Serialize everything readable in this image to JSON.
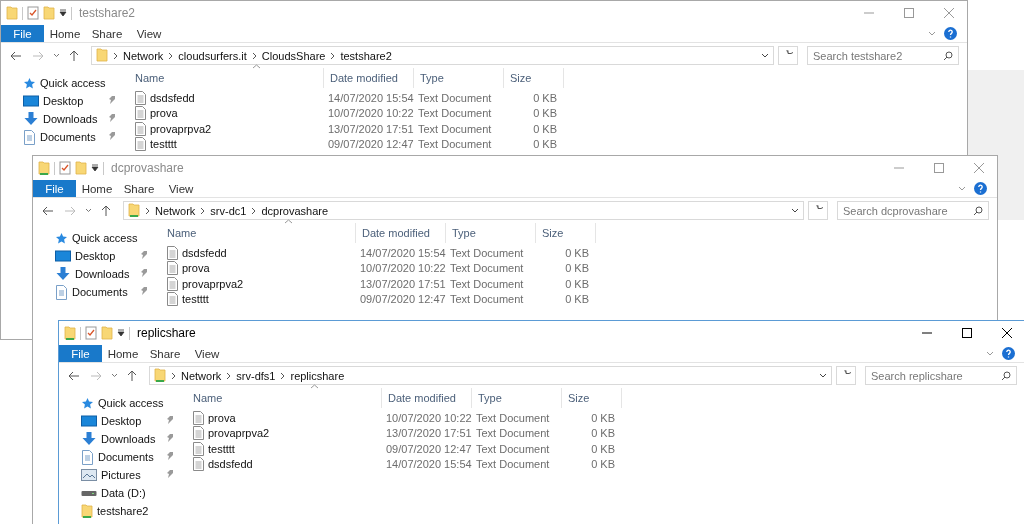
{
  "windows": [
    {
      "title": "testshare2",
      "active": false,
      "ribbon_tabs": [
        {
          "label": "File",
          "kind": "file"
        },
        {
          "label": "Home",
          "kind": "tab"
        },
        {
          "label": "Share",
          "kind": "tab"
        },
        {
          "label": "View",
          "kind": "tab"
        }
      ],
      "path": [
        "Network",
        "cloudsurfers.it",
        "CloudsShare",
        "testshare2"
      ],
      "search": {
        "placeholder": "Search testshare2"
      },
      "sidebar": [
        {
          "label": "Quick access",
          "pinned": false
        },
        {
          "label": "Desktop",
          "pinned": true
        },
        {
          "label": "Downloads",
          "pinned": true
        },
        {
          "label": "Documents",
          "pinned": true
        }
      ],
      "columns": [
        "Name",
        "Date modified",
        "Type",
        "Size"
      ],
      "files": [
        {
          "name": "dsdsfedd",
          "date": "14/07/2020 15:54",
          "type": "Text Document",
          "size": "0 KB"
        },
        {
          "name": "prova",
          "date": "10/07/2020 10:22",
          "type": "Text Document",
          "size": "0 KB"
        },
        {
          "name": "provaprpva2",
          "date": "13/07/2020 17:51",
          "type": "Text Document",
          "size": "0 KB"
        },
        {
          "name": "testttt",
          "date": "09/07/2020 12:47",
          "type": "Text Document",
          "size": "0 KB"
        }
      ]
    },
    {
      "title": "dcprovashare",
      "active": false,
      "ribbon_tabs": [
        {
          "label": "File",
          "kind": "file"
        },
        {
          "label": "Home",
          "kind": "tab"
        },
        {
          "label": "Share",
          "kind": "tab"
        },
        {
          "label": "View",
          "kind": "tab"
        }
      ],
      "path": [
        "Network",
        "srv-dc1",
        "dcprovashare"
      ],
      "search": {
        "placeholder": "Search dcprovashare"
      },
      "sidebar": [
        {
          "label": "Quick access",
          "pinned": false
        },
        {
          "label": "Desktop",
          "pinned": true
        },
        {
          "label": "Downloads",
          "pinned": true
        },
        {
          "label": "Documents",
          "pinned": true
        }
      ],
      "columns": [
        "Name",
        "Date modified",
        "Type",
        "Size"
      ],
      "files": [
        {
          "name": "dsdsfedd",
          "date": "14/07/2020 15:54",
          "type": "Text Document",
          "size": "0 KB"
        },
        {
          "name": "prova",
          "date": "10/07/2020 10:22",
          "type": "Text Document",
          "size": "0 KB"
        },
        {
          "name": "provaprpva2",
          "date": "13/07/2020 17:51",
          "type": "Text Document",
          "size": "0 KB"
        },
        {
          "name": "testttt",
          "date": "09/07/2020 12:47",
          "type": "Text Document",
          "size": "0 KB"
        }
      ]
    },
    {
      "title": "replicshare",
      "active": true,
      "ribbon_tabs": [
        {
          "label": "File",
          "kind": "file"
        },
        {
          "label": "Home",
          "kind": "tab"
        },
        {
          "label": "Share",
          "kind": "tab"
        },
        {
          "label": "View",
          "kind": "tab"
        }
      ],
      "path": [
        "Network",
        "srv-dfs1",
        "replicshare"
      ],
      "search": {
        "placeholder": "Search replicshare"
      },
      "sidebar": [
        {
          "label": "Quick access",
          "pinned": false
        },
        {
          "label": "Desktop",
          "pinned": true
        },
        {
          "label": "Downloads",
          "pinned": true
        },
        {
          "label": "Documents",
          "pinned": true
        },
        {
          "label": "Pictures",
          "pinned": true
        },
        {
          "label": "Data (D:)",
          "pinned": false
        },
        {
          "label": "testshare2",
          "pinned": false
        }
      ],
      "columns": [
        "Name",
        "Date modified",
        "Type",
        "Size"
      ],
      "files": [
        {
          "name": "prova",
          "date": "10/07/2020 10:22",
          "type": "Text Document",
          "size": "0 KB"
        },
        {
          "name": "provaprpva2",
          "date": "13/07/2020 17:51",
          "type": "Text Document",
          "size": "0 KB"
        },
        {
          "name": "testttt",
          "date": "09/07/2020 12:47",
          "type": "Text Document",
          "size": "0 KB"
        },
        {
          "name": "dsdsfedd",
          "date": "14/07/2020 15:54",
          "type": "Text Document",
          "size": "0 KB"
        }
      ]
    }
  ]
}
